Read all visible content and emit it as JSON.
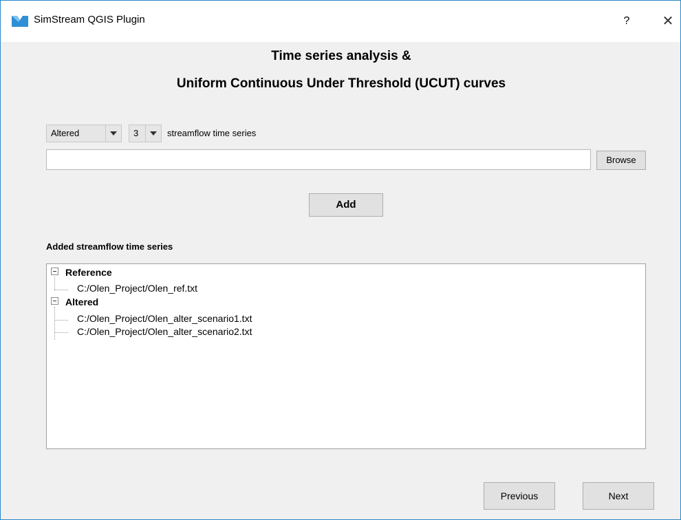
{
  "window": {
    "title": "SimStream QGIS Plugin",
    "help_label": "?",
    "close_label": "✕"
  },
  "heading": {
    "line1": "Time series analysis &",
    "line2": "Uniform Continuous Under Threshold (UCUT) curves"
  },
  "form": {
    "series_type_selected": "Altered",
    "series_count_selected": "3",
    "series_label": "streamflow time series",
    "path_value": "",
    "browse_label": "Browse",
    "add_label": "Add"
  },
  "list": {
    "caption": "Added streamflow time series",
    "groups": [
      {
        "label": "Reference",
        "items": [
          "C:/Olen_Project/Olen_ref.txt"
        ]
      },
      {
        "label": "Altered",
        "items": [
          "C:/Olen_Project/Olen_alter_scenario1.txt",
          "C:/Olen_Project/Olen_alter_scenario2.txt"
        ]
      }
    ]
  },
  "footer": {
    "previous_label": "Previous",
    "next_label": "Next"
  },
  "colors": {
    "window_border": "#2b86c8",
    "icon_blue": "#2f8fd6"
  }
}
